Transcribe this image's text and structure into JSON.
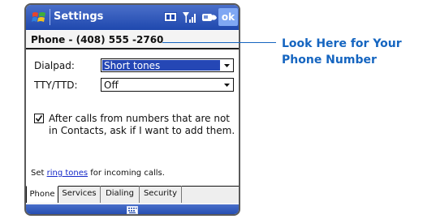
{
  "titlebar": {
    "title": "Settings",
    "ok_label": "ok",
    "icons": [
      "windows-start-icon",
      "input-mode-icon",
      "signal-icon",
      "connectivity-icon"
    ]
  },
  "phone_header": {
    "number": "Phone - (408) 555 -2760"
  },
  "form": {
    "dialpad_label": "Dialpad:",
    "dialpad_value": "Short tones",
    "tty_label": "TTY/TTD:",
    "tty_value": "Off",
    "checkbox_checked": true,
    "checkbox_text": "After calls from numbers that are not in Contacts, ask if I want to add them.",
    "footer_prefix": "Set ",
    "footer_link": "ring tones",
    "footer_suffix": " for incoming calls."
  },
  "tabs": [
    {
      "label": "Phone",
      "active": true
    },
    {
      "label": "Services",
      "active": false
    },
    {
      "label": "Dialing",
      "active": false
    },
    {
      "label": "Security",
      "active": false
    }
  ],
  "callout": {
    "line1": "Look Here for Your",
    "line2": "Phone Number",
    "color": "#1565c0"
  },
  "colors": {
    "titlebar": "#2a52be",
    "selection": "#2547b5",
    "link": "#1428c8"
  }
}
